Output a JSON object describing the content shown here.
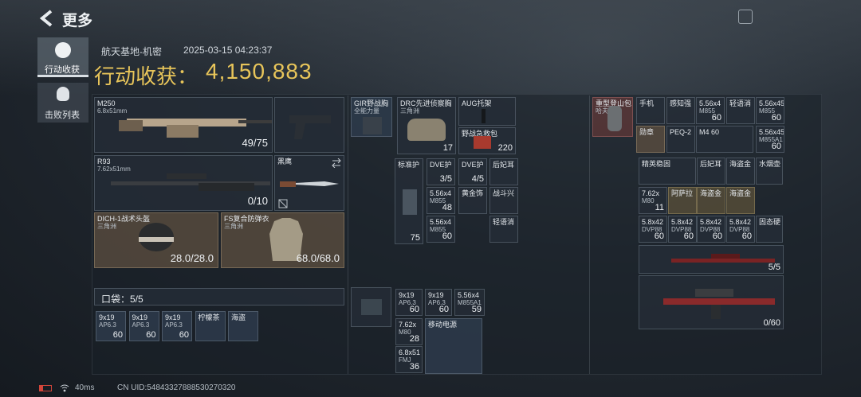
{
  "header": {
    "back_label": "更多",
    "location": "航天基地-机密",
    "datetime": "2025-03-15 04:23:37",
    "haul_label": "行动收获：",
    "haul_value": "4,150,883"
  },
  "side_tabs": [
    {
      "label": "行动收获"
    },
    {
      "label": "击败列表"
    }
  ],
  "weapons": [
    {
      "name": "M250",
      "caliber": "6.8x51mm",
      "ammo": "49/75"
    },
    {
      "name": "R93",
      "caliber": "7.62x51mm",
      "ammo": "0/10"
    }
  ],
  "melee": {
    "name": "黑鹰"
  },
  "armor": [
    {
      "name": "DICH-1战术头盔",
      "maker": "三角洲",
      "durability": "28.0/28.0"
    },
    {
      "name": "FS复合防弹衣",
      "maker": "三角洲",
      "durability": "68.0/68.0"
    }
  ],
  "pocket": {
    "label": "口袋：5/5",
    "items": [
      {
        "n": "9x19",
        "n2": "AP6.3",
        "q": "60"
      },
      {
        "n": "9x19",
        "n2": "AP6.3",
        "q": "60"
      },
      {
        "n": "9x19",
        "n2": "AP6.3",
        "q": "60"
      },
      {
        "n": "柠檬茶",
        "n2": "",
        "q": ""
      },
      {
        "n": "海盗",
        "n2": "",
        "q": ""
      }
    ]
  },
  "chest": [
    {
      "n": "GIR野战胸",
      "n2": "全能力量"
    },
    {
      "n": "DRC先进侦察胸",
      "n2": "三角洲",
      "q": "17"
    },
    {
      "n": "AUG托架",
      "n2": ""
    },
    {
      "n": "野战急救包",
      "q": "220"
    }
  ],
  "chest_slots": [
    {
      "n": "标准护",
      "q": "75"
    },
    {
      "n": "DVE护",
      "q": "3/5"
    },
    {
      "n": "DVE护",
      "q": "4/5"
    },
    {
      "n": "后妃耳",
      "q": ""
    },
    {
      "n": "5.56x4",
      "n2": "M855",
      "q": "48"
    },
    {
      "n": "黄金饰",
      "q": ""
    },
    {
      "n": "战斗兴",
      "q": ""
    },
    {
      "n": "5.56x4",
      "n2": "M855",
      "q": "60"
    },
    {
      "n": "轻语消",
      "q": ""
    }
  ],
  "backpack_small": [
    {
      "n": "9x19",
      "n2": "AP6.3",
      "q": "60"
    },
    {
      "n": "9x19",
      "n2": "AP6.3",
      "q": "60"
    },
    {
      "n": "5.56x4",
      "n2": "M855A1",
      "q": "59"
    },
    {
      "n": "7.62x",
      "n2": "M80",
      "q": "28"
    },
    {
      "n": "6.8x51",
      "n2": "FMJ",
      "q": "36"
    },
    {
      "n": "移动电源",
      "q": ""
    }
  ],
  "bag": {
    "n": "重型登山包",
    "n2": "哈夫克"
  },
  "right_top": [
    {
      "n": "手机",
      "q": ""
    },
    {
      "n": "感知强",
      "q": ""
    },
    {
      "n": "5.56x4",
      "n2": "M855",
      "q": "60"
    },
    {
      "n": "轻语消",
      "q": ""
    },
    {
      "n": "5.56x45",
      "n2": "M855",
      "q": "60"
    },
    {
      "n": "勋章",
      "q": ""
    },
    {
      "n": "PEQ-2",
      "q": ""
    },
    {
      "n": "M4 60",
      "q": ""
    },
    {
      "n": "5.56x45",
      "n2": "M855A1",
      "q": "60"
    }
  ],
  "right_grid": [
    {
      "n": "精英稳固",
      "q": ""
    },
    {
      "n": "后妃耳",
      "q": ""
    },
    {
      "n": "海盗金",
      "q": ""
    },
    {
      "n": "水烟壶",
      "q": ""
    },
    {
      "n": "7.62x",
      "n2": "M80",
      "q": "11"
    },
    {
      "n": "阿萨拉",
      "q": ""
    },
    {
      "n": "海盗金",
      "q": ""
    },
    {
      "n": "海盗金",
      "q": ""
    },
    {
      "n": "5.8x42",
      "n2": "DVP88",
      "q": "60"
    },
    {
      "n": "5.8x42",
      "n2": "DVP88",
      "q": "60"
    },
    {
      "n": "5.8x42",
      "n2": "DVP88",
      "q": "60"
    },
    {
      "n": "5.8x42",
      "n2": "DVP88",
      "q": "60"
    },
    {
      "n": "固态硬",
      "q": ""
    }
  ],
  "right_weapons": [
    {
      "ammo": "5/5"
    },
    {
      "ammo": "0/60"
    }
  ],
  "status": {
    "ping": "40ms",
    "uid": "CN UID:5484332788853027032​0"
  }
}
